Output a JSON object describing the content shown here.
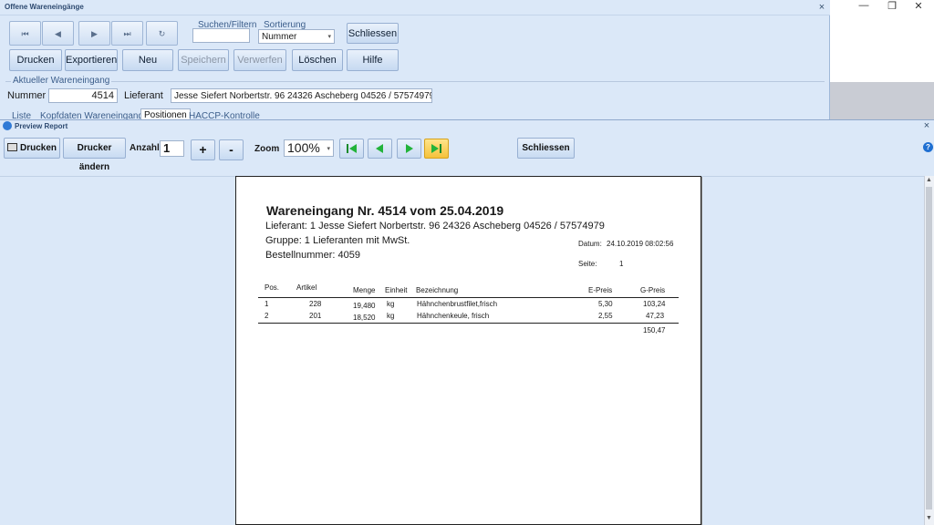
{
  "back_window": {
    "title": "Offene Wareneingänge",
    "close": "×",
    "nav": {
      "first": "⏮",
      "prev": "◀",
      "next": "▶",
      "last": "⏭",
      "refresh": "↻"
    },
    "search_label": "Suchen/Filtern",
    "search_value": "",
    "sort_label": "Sortierung",
    "sort_value": "Nummer",
    "close_button": "Schliessen",
    "buttons": {
      "print": "Drucken",
      "export": "Exportieren",
      "new": "Neu",
      "save": "Speichern",
      "discard": "Verwerfen",
      "delete": "Löschen",
      "help": "Hilfe"
    },
    "section_label": "Aktueller Wareneingang",
    "number_label": "Nummer",
    "number_value": "4514",
    "supplier_label": "Lieferant",
    "supplier_value": "Jesse Siefert Norbertstr. 96 24326 Ascheberg 04526 / 57574979",
    "tabs": [
      "Liste",
      "Kopfdaten Wareneingang",
      "Positionen",
      "HACCP-Kontrolle"
    ]
  },
  "window_controls": {
    "minimize": "—",
    "restore": "❐",
    "close": "✕"
  },
  "preview_window": {
    "title": "Preview Report",
    "close": "×",
    "help": "?",
    "toolbar": {
      "print": "Drucken",
      "change_printer": "Drucker ändern",
      "count_label": "Anzahl",
      "count_value": "1",
      "plus": "+",
      "minus": "-",
      "zoom_label": "Zoom",
      "zoom_value": "100%",
      "close": "Schliessen"
    }
  },
  "report": {
    "title": "Wareneingang Nr. 4514 vom 25.04.2019",
    "supplier_line": "Lieferant: 1 Jesse Siefert Norbertstr. 96 24326 Ascheberg 04526 / 57574979",
    "group_line": "Gruppe: 1 Lieferanten mit MwSt.",
    "order_line": "Bestellnummer: 4059",
    "date_label": "Datum:",
    "date_value": "24.10.2019 08:02:56",
    "page_label": "Seite:",
    "page_value": "1",
    "columns": [
      "Pos.",
      "Artikel",
      "Menge",
      "Einheit",
      "Bezeichnung",
      "E-Preis",
      "G-Preis"
    ],
    "rows": [
      [
        "1",
        "228",
        "19,480",
        "kg",
        "Hähnchenbrustfilet,frisch",
        "5,30",
        "103,24"
      ],
      [
        "2",
        "201",
        "18,520",
        "kg",
        "Hähnchenkeule, frisch",
        "2,55",
        "47,23"
      ]
    ],
    "total": "150,47"
  }
}
